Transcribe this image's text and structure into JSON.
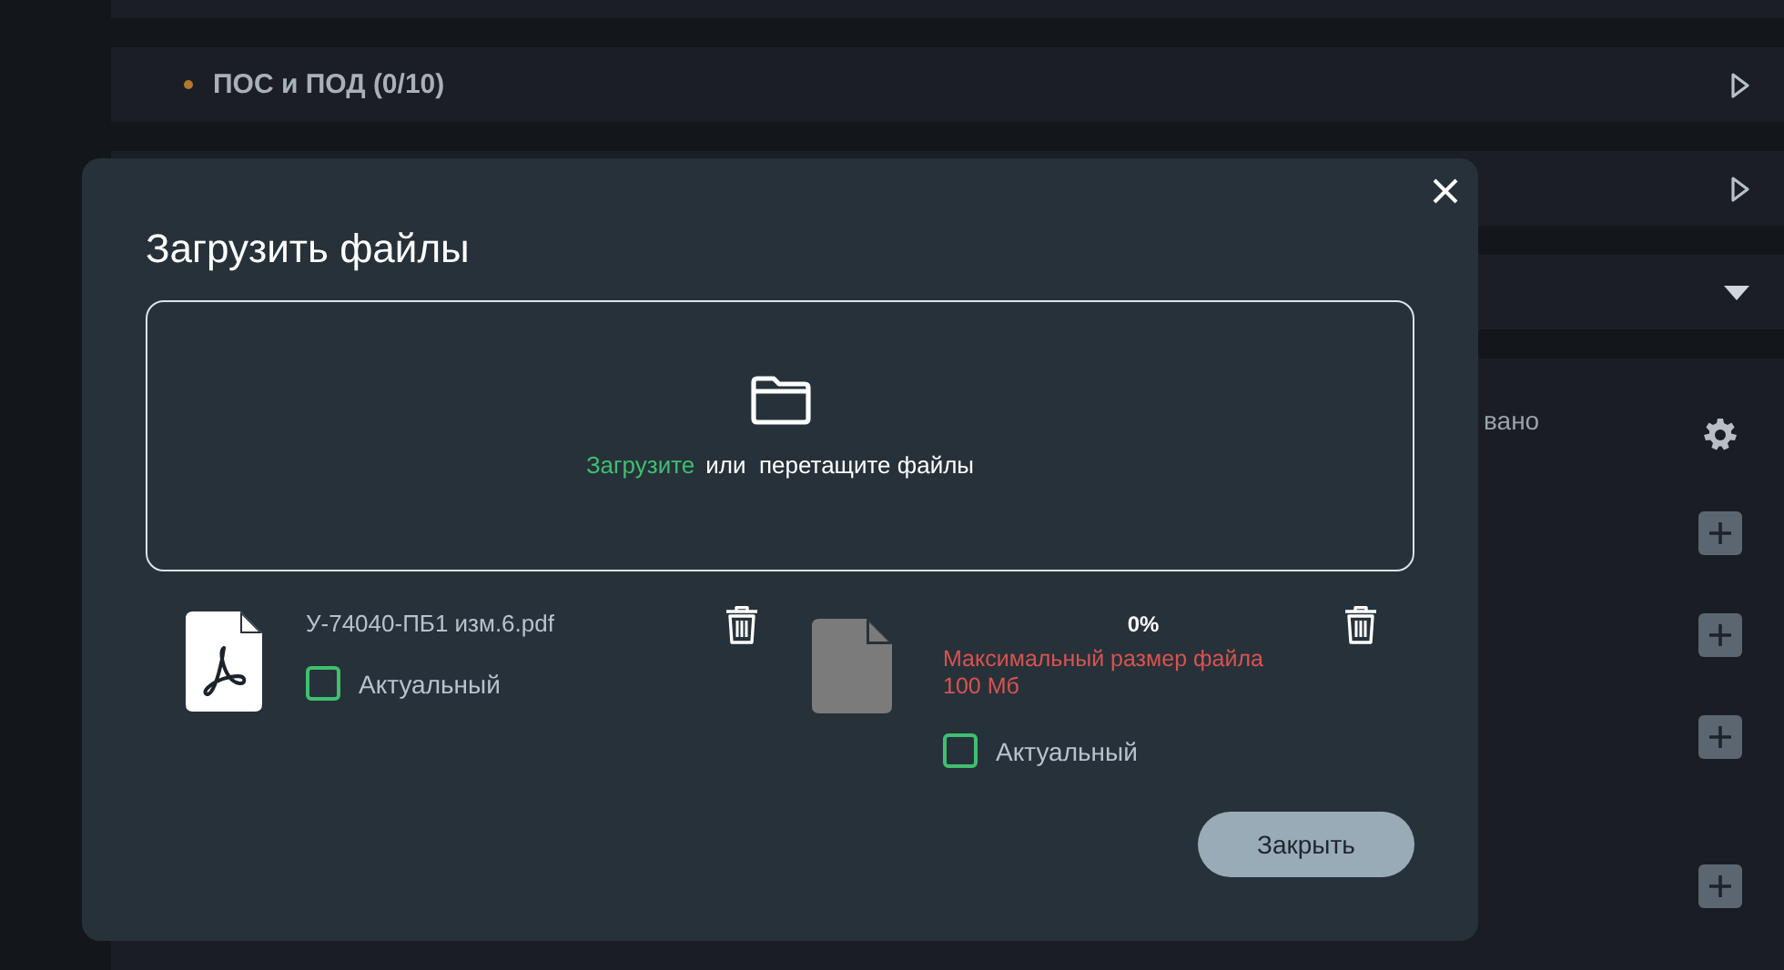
{
  "background": {
    "sections": [
      {
        "title": "ПОС и ПОД (0/10)",
        "expanded": false
      },
      {
        "expanded": false
      },
      {
        "expanded": true
      }
    ],
    "panel_text": "вано"
  },
  "modal": {
    "title": "Загрузить файлы",
    "dropzone": {
      "link": "Загрузите",
      "text": "или  перетащите файлы"
    },
    "files": [
      {
        "kind": "pdf",
        "name": "У-74040-ПБ1 изм.6.pdf",
        "actual_label": "Актуальный",
        "checked": false
      },
      {
        "kind": "error",
        "progress": "0%",
        "level": 0,
        "error": "Максимальный размер файла 100 Мб",
        "actual_label": "Актуальный",
        "checked": false
      }
    ],
    "close_button": "Закрыть"
  }
}
